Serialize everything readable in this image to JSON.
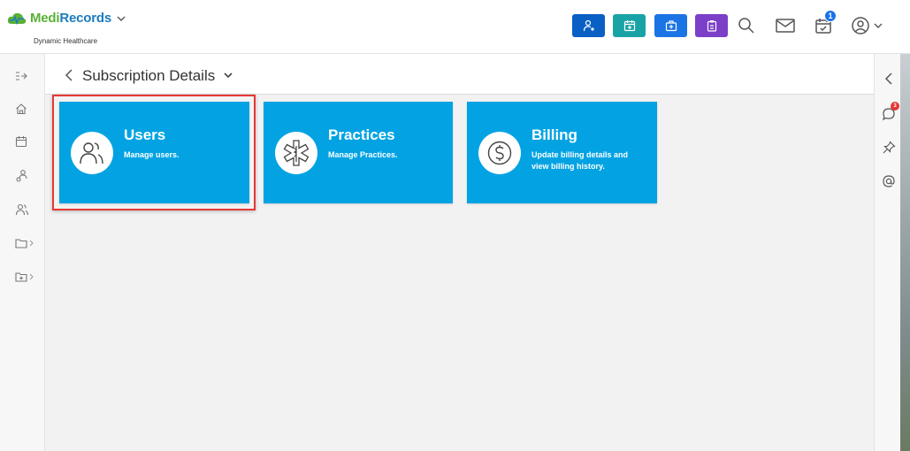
{
  "brand": {
    "name_part1": "Medi",
    "name_part2": "Records",
    "subtitle": "Dynamic Healthcare"
  },
  "header": {
    "actions": [
      {
        "name": "add-patient",
        "icon": "user-plus-icon",
        "color": "#0a5fc4"
      },
      {
        "name": "schedule-appointment",
        "icon": "calendar-plus-icon",
        "color": "#1aa3a6"
      },
      {
        "name": "add-encounter",
        "icon": "medical-kit-icon",
        "color": "#1b74e4"
      },
      {
        "name": "clipboard-task",
        "icon": "clipboard-icon",
        "color": "#7b3fc8"
      }
    ],
    "task_badge_count": "1"
  },
  "sidebar": {
    "items": [
      {
        "icon": "expand-menu-icon"
      },
      {
        "icon": "home-icon"
      },
      {
        "icon": "calendar-icon"
      },
      {
        "icon": "patients-group-icon"
      },
      {
        "icon": "users-icon"
      },
      {
        "icon": "folder-icon"
      },
      {
        "icon": "folder-add-icon"
      }
    ]
  },
  "rail": {
    "notification_count": "3",
    "icons": [
      "collapse-left-icon",
      "chat-icon",
      "pin-icon",
      "at-mention-icon"
    ]
  },
  "page": {
    "title": "Subscription Details"
  },
  "tiles": [
    {
      "title": "Users",
      "description": "Manage users.",
      "icon": "users-icon"
    },
    {
      "title": "Practices",
      "description": "Manage Practices.",
      "icon": "star-of-life-icon"
    },
    {
      "title": "Billing",
      "description": "Update billing details and view billing history.",
      "icon": "dollar-coin-icon"
    }
  ],
  "colors": {
    "tile": "#03a3e3",
    "highlight": "#e53935"
  }
}
